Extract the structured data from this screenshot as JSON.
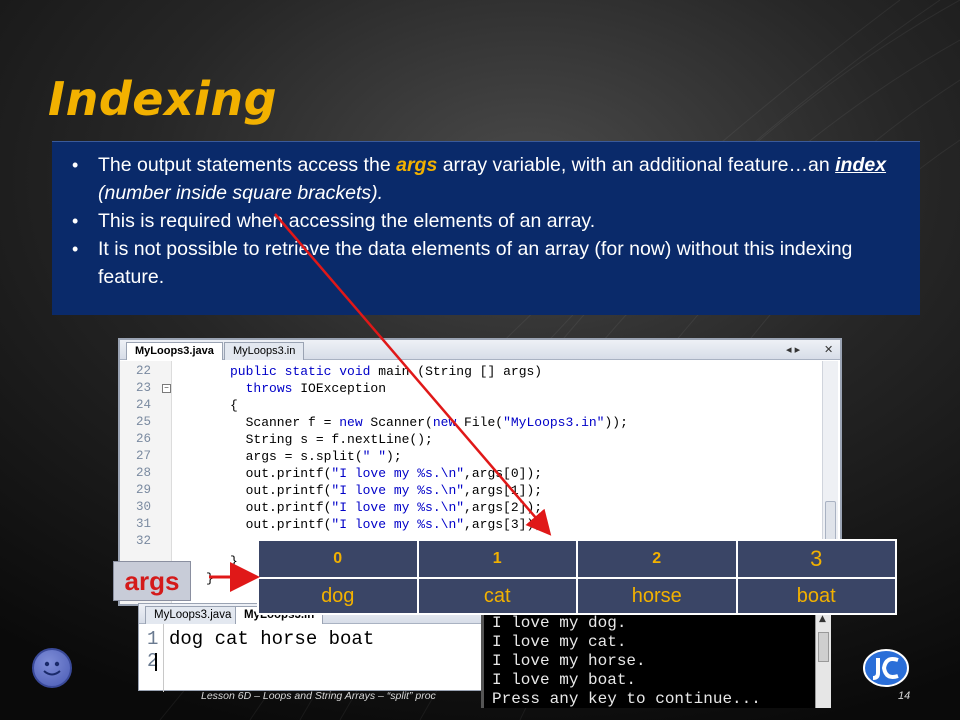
{
  "slide": {
    "title": "Indexing",
    "bullets": [
      {
        "pre": "The output statements access the ",
        "kw": "args",
        "post1": " array variable, with an additional feature…an ",
        "kw2": "index",
        "post2": " (number inside square brackets)."
      },
      {
        "text": "This is required when accessing the elements of an array."
      },
      {
        "text": "It is not possible to retrieve the data elements of an array (for now) without this indexing feature."
      }
    ],
    "footer": "Lesson 6D – Loops and String Arrays – “split” proc",
    "page_number": "14"
  },
  "editor": {
    "tabs": [
      "MyLoops3.java",
      "MyLoops3.in"
    ],
    "controls": [
      "◂ ▸",
      "✕"
    ],
    "lines": [
      {
        "ln": "22",
        "code": "public static void main (String [] args)"
      },
      {
        "ln": "23",
        "code": "  throws IOException",
        "fold": "−"
      },
      {
        "ln": "24",
        "code": "{"
      },
      {
        "ln": "25",
        "code": "  Scanner f = new Scanner(new File(\"MyLoops3.in\"));"
      },
      {
        "ln": "26",
        "code": "  String s = f.nextLine();"
      },
      {
        "ln": "27",
        "code": "  args = s.split(\" \");"
      },
      {
        "ln": "28",
        "code": "  out.printf(\"I love my %s.\\n\",args[0]);"
      },
      {
        "ln": "29",
        "code": "  out.printf(\"I love my %s.\\n\",args[1]);"
      },
      {
        "ln": "30",
        "code": "  out.printf(\"I love my %s.\\n\",args[2]);"
      },
      {
        "ln": "31",
        "code": "  out.printf(\"I love my %s.\\n\",args[3]);"
      },
      {
        "ln": "32",
        "code": ""
      },
      {
        "ln": "",
        "code": "}"
      },
      {
        "ln": "",
        "code": "}"
      }
    ]
  },
  "lower_editor": {
    "tabs": [
      "MyLoops3.java",
      "MyLoops3.in"
    ],
    "lines": [
      {
        "ln": "1",
        "code": "dog cat horse boat"
      },
      {
        "ln": "2",
        "code": ""
      }
    ]
  },
  "console": {
    "lines": [
      "I love my dog.",
      "I love my cat.",
      "I love my horse.",
      "I love my boat.",
      "Press any key to continue..."
    ]
  },
  "array_diagram": {
    "label": "args",
    "indices": [
      "0",
      "1",
      "2",
      "3"
    ],
    "values": [
      "dog",
      "cat",
      "horse",
      "boat"
    ]
  },
  "colors": {
    "title": "#f2b100",
    "bullet_box": "#0a2a6a",
    "table_cell": "#3a4566",
    "arrow": "#e01818",
    "args_label": "#d41a1a"
  }
}
